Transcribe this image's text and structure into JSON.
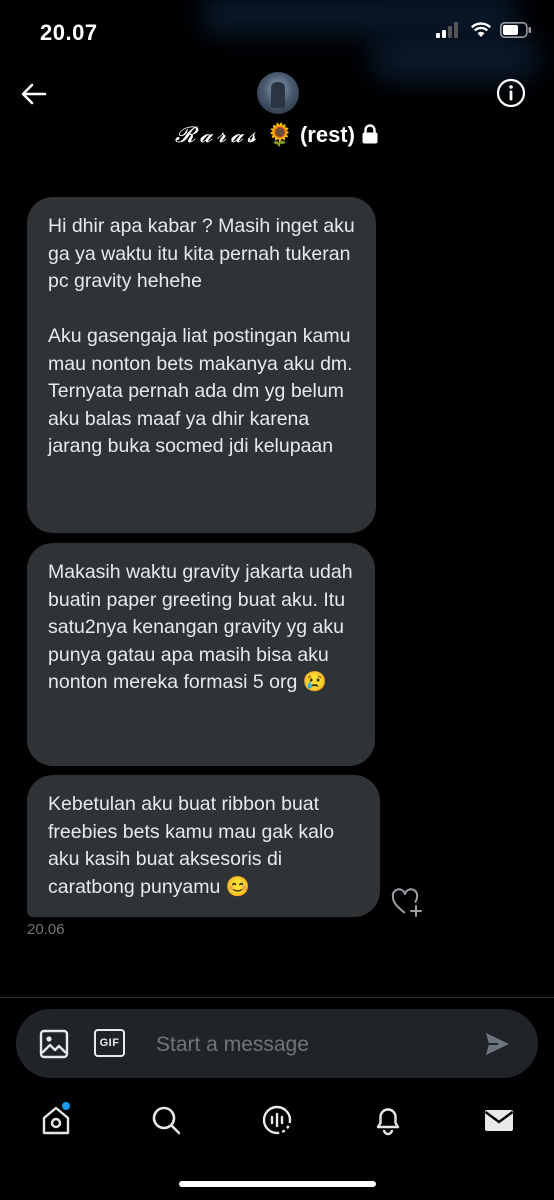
{
  "status": {
    "time": "20.07"
  },
  "header": {
    "name": "𝓡𝓪𝓻𝓪𝓼",
    "emoji": "🌻",
    "suffix": "(rest)"
  },
  "messages": [
    {
      "text": "Hi dhir apa kabar ? Masih inget aku ga ya waktu itu kita pernah tukeran pc gravity hehehe\n\nAku gasengaja liat postingan kamu mau nonton bets makanya aku dm. Ternyata pernah ada dm yg belum aku balas maaf ya dhir karena jarang buka socmed jdi kelupaan"
    },
    {
      "text": "Makasih waktu gravity jakarta udah buatin paper greeting buat aku. Itu satu2nya kenangan gravity yg aku punya gatau apa masih bisa aku nonton mereka formasi 5 org 😢"
    },
    {
      "text": "Kebetulan aku buat ribbon buat freebies bets kamu mau gak kalo aku kasih buat aksesoris di caratbong punyamu 😊"
    }
  ],
  "timestamp": "20.06",
  "composer": {
    "placeholder": "Start a message",
    "gif_label": "GIF"
  },
  "icons": {
    "back": "back-arrow-icon",
    "info": "info-icon",
    "media": "image-icon",
    "send": "send-icon",
    "home": "home-icon",
    "search": "search-icon",
    "spaces": "spaces-icon",
    "notifications": "bell-icon",
    "messages": "mail-icon"
  },
  "colors": {
    "accent": "#1d9bf0",
    "bubble": "#2f3336",
    "background": "#000000"
  }
}
